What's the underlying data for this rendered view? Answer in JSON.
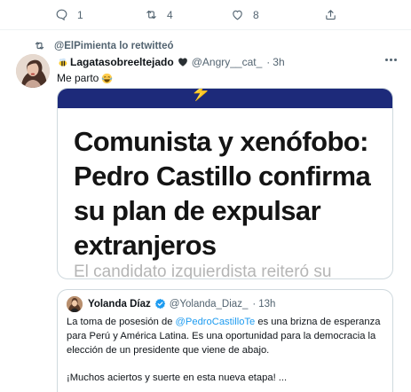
{
  "action_bar": {
    "reply_count": "1",
    "retweet_count": "4",
    "like_count": "8"
  },
  "retweet_context": {
    "text": "@ElPimienta lo retwitteó"
  },
  "tweet": {
    "display_name": "Lagatasobreeltejado",
    "handle": "@Angry__cat_",
    "separator": "·",
    "time": "3h",
    "text": "Me parto",
    "icons": [
      "bee-emoji-icon",
      "black-heart-icon",
      "laughing-emoji-icon",
      "more-options-icon"
    ],
    "media": {
      "headline": "Comunista y xenófobo: Pedro Castillo confirma su plan de expulsar extranjeros",
      "subline": "El candidato izquierdista reiteró su",
      "colors": {
        "banner": "#1d2a7a",
        "headline": "#141414",
        "subline": "#b5b5b5"
      }
    }
  },
  "quote": {
    "display_name": "Yolanda Díaz",
    "handle": "@Yolanda_Diaz_",
    "separator": "·",
    "time": "13h",
    "body_1_before": "La toma de posesión de ",
    "body_1_mention": "@PedroCastilloTe",
    "body_1_after": " es una brizna de esperanza para Perú y América Latina. Es una oportunidad para la democracia la elección de un presidente que viene de abajo.",
    "body_2": "¡Muchos aciertos y suerte en esta nueva etapa! ..."
  },
  "colors": {
    "accent": "#1d9bf0",
    "muted_text": "#536471",
    "border": "#cfd9de"
  }
}
